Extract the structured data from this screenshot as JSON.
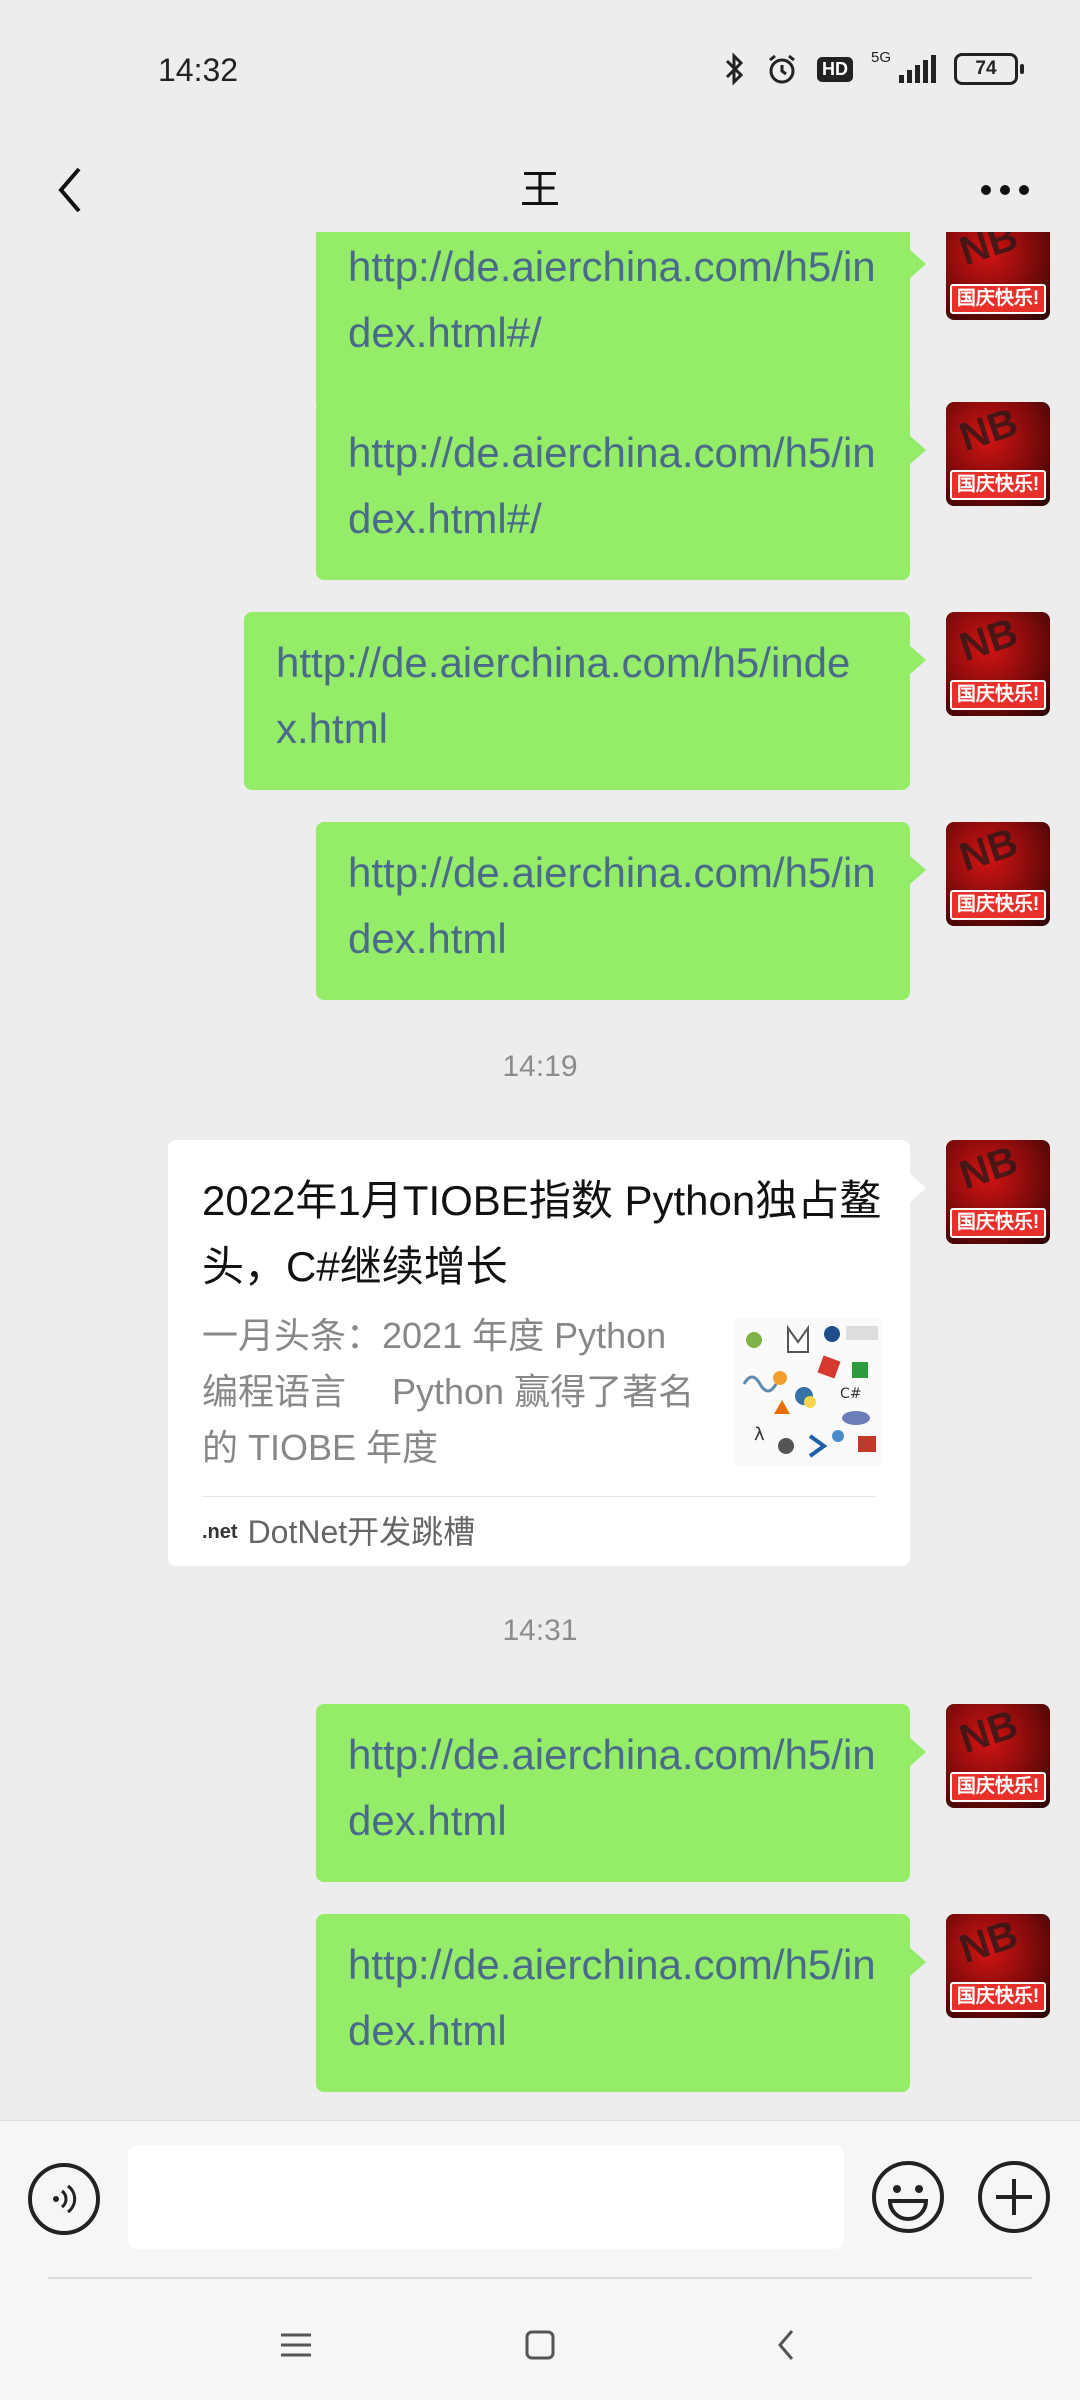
{
  "status_bar": {
    "time": "14:32",
    "network": "5G",
    "hd": "HD",
    "battery": "74"
  },
  "header": {
    "title": "王"
  },
  "messages_before": [
    {
      "text": "http://de.aierchina.com/h5/index.html#/"
    },
    {
      "text": "http://de.aierchina.com/h5/index.html#/"
    },
    {
      "text": "http://de.aierchina.com/h5/index.html"
    },
    {
      "text": "http://de.aierchina.com/h5/index.html"
    }
  ],
  "timestamp_1": "14:19",
  "card": {
    "title": "2022年1月TIOBE指数 Python独占鳌头，C#继续增长",
    "description": "一月头条：2021 年度 Python 编程语言　 Python 赢得了著名的 TIOBE 年度",
    "source_logo": ".net",
    "source": "DotNet开发跳槽"
  },
  "timestamp_2": "14:31",
  "messages_after": [
    {
      "text": "http://de.aierchina.com/h5/index.html"
    },
    {
      "text": "http://de.aierchina.com/h5/index.html"
    }
  ],
  "avatar": {
    "badge": "国庆快乐!",
    "letters": "NB"
  },
  "input": {
    "placeholder": ""
  },
  "colors": {
    "bubble": "#95ec69",
    "link_text": "#4a6a8a",
    "background": "#ededed"
  }
}
